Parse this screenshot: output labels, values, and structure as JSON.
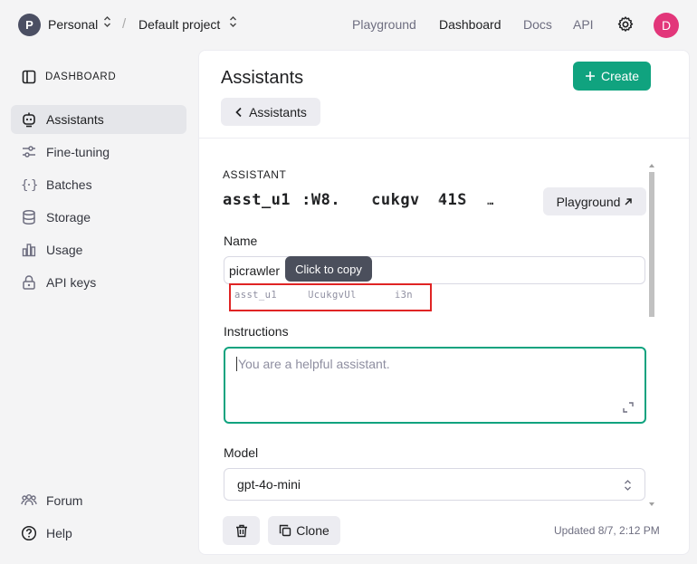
{
  "topbar": {
    "org_initial": "P",
    "org_name": "Personal",
    "separator": "/",
    "project_name": "Default project",
    "nav": [
      "Playground",
      "Dashboard",
      "Docs",
      "API"
    ],
    "active_nav": "Dashboard",
    "user_initial": "D"
  },
  "sidebar": {
    "heading": "DASHBOARD",
    "items": [
      {
        "label": "Assistants",
        "icon": "robot-icon",
        "active": true
      },
      {
        "label": "Fine-tuning",
        "icon": "sliders-icon"
      },
      {
        "label": "Batches",
        "icon": "braces-icon"
      },
      {
        "label": "Storage",
        "icon": "database-icon"
      },
      {
        "label": "Usage",
        "icon": "bar-chart-icon"
      },
      {
        "label": "API keys",
        "icon": "lock-icon"
      }
    ],
    "footer": [
      {
        "label": "Forum",
        "icon": "users-icon"
      },
      {
        "label": "Help",
        "icon": "help-icon"
      }
    ]
  },
  "main": {
    "title": "Assistants",
    "create_label": "Create",
    "back_label": "Assistants",
    "section_label": "ASSISTANT",
    "assistant_id_parts": [
      "asst_u1",
      ":W8.",
      "cukgv",
      "41S",
      "…"
    ],
    "playground_label": "Playground",
    "name_label": "Name",
    "name_value": "picrawler",
    "tooltip": "Click to copy",
    "copy_id_parts": [
      "asst_u1",
      "UcukgvUl",
      "i3n"
    ],
    "instructions_label": "Instructions",
    "instructions_placeholder": "You are a helpful assistant.",
    "model_label": "Model",
    "model_value": "gpt-4o-mini",
    "clone_label": "Clone",
    "updated": "Updated 8/7, 2:12 PM"
  },
  "colors": {
    "accent": "#10a37f",
    "highlight_box": "#e02424",
    "avatar": "#e2367a"
  }
}
